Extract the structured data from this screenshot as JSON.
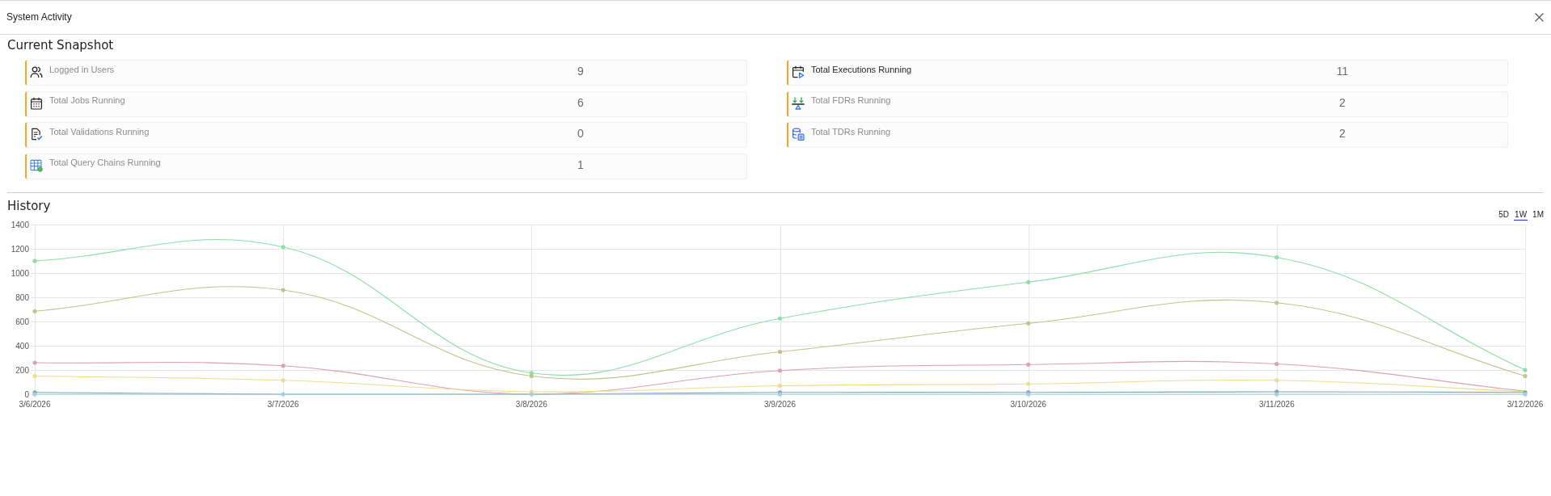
{
  "window": {
    "title": "System Activity"
  },
  "snapshot": {
    "title": "Current Snapshot",
    "columns": [
      {
        "items": [
          {
            "label": "Logged in Users",
            "value": "9",
            "highlighted": false
          },
          {
            "label": "Total Jobs Running",
            "value": "6",
            "highlighted": false
          },
          {
            "label": "Total Validations Running",
            "value": "0",
            "highlighted": false
          },
          {
            "label": "Total Query Chains Running",
            "value": "1",
            "highlighted": false
          }
        ]
      },
      {
        "items": [
          {
            "label": "Total Executions Running",
            "value": "11",
            "highlighted": true
          },
          {
            "label": "Total FDRs Running",
            "value": "2",
            "highlighted": false
          },
          {
            "label": "Total TDRs Running",
            "value": "2",
            "highlighted": false
          }
        ]
      }
    ]
  },
  "history": {
    "title": "History",
    "ranges": [
      {
        "label": "5D",
        "selected": false
      },
      {
        "label": "1W",
        "selected": true
      },
      {
        "label": "1M",
        "selected": false
      }
    ],
    "chart_data": {
      "type": "line",
      "grid": true,
      "categories": [
        "3/6/2026",
        "3/7/2026",
        "3/8/2026",
        "3/9/2026",
        "3/10/2026",
        "3/11/2026",
        "3/12/2026"
      ],
      "ylim": [
        0,
        1400
      ],
      "yticks": [
        0,
        200,
        400,
        600,
        800,
        1000,
        1200,
        1400
      ],
      "series": [
        {
          "color": "#a6cde0",
          "marker": true,
          "values": [
            0,
            0,
            0,
            0,
            0,
            0,
            0
          ]
        },
        {
          "color": "#78a8b5",
          "marker": true,
          "values": [
            15,
            0,
            0,
            15,
            15,
            20,
            15
          ]
        },
        {
          "color": "#f0dc8e",
          "marker": true,
          "values": [
            150,
            115,
            20,
            70,
            85,
            115,
            20
          ]
        },
        {
          "color": "#d9a2b6",
          "marker": true,
          "values": [
            260,
            235,
            0,
            195,
            245,
            250,
            25
          ]
        },
        {
          "color": "#c2c38a",
          "marker": true,
          "values": [
            685,
            860,
            150,
            350,
            585,
            755,
            150
          ]
        },
        {
          "color": "#8ddfa6",
          "marker": true,
          "values": [
            1100,
            1215,
            175,
            625,
            925,
            1130,
            200
          ]
        }
      ]
    }
  }
}
